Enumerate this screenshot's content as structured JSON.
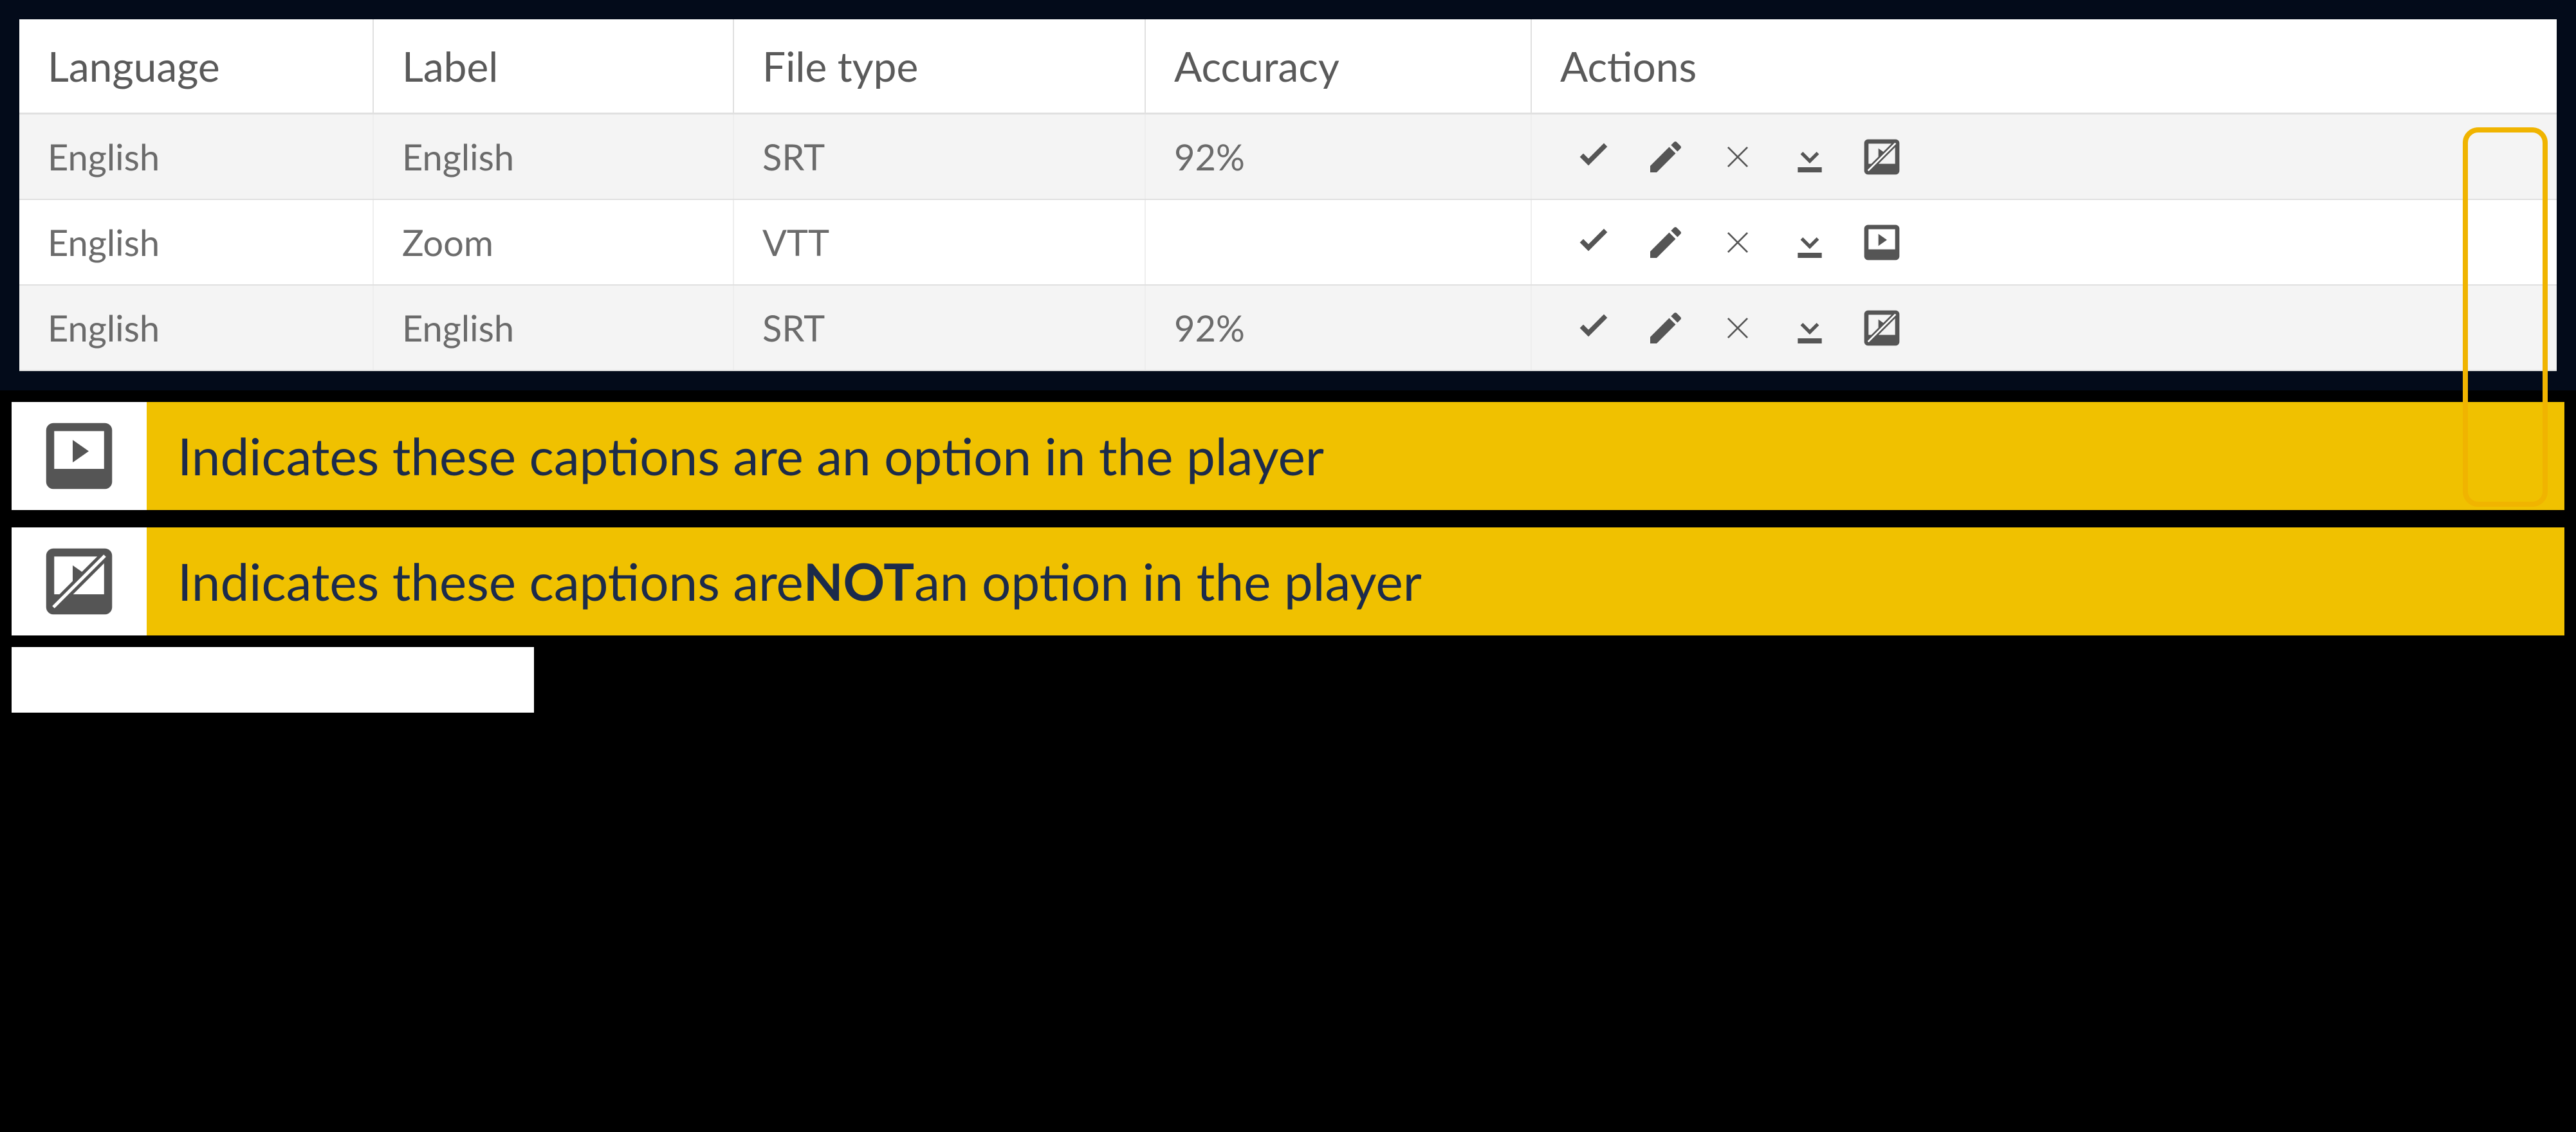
{
  "columns": {
    "language": "Language",
    "label": "Label",
    "file_type": "File type",
    "accuracy": "Accuracy",
    "actions": "Actions"
  },
  "rows": [
    {
      "language": "English",
      "label": "English",
      "file_type": "SRT",
      "accuracy": "92%",
      "player_option": false
    },
    {
      "language": "English",
      "label": "Zoom",
      "file_type": "VTT",
      "accuracy": "",
      "player_option": true
    },
    {
      "language": "English",
      "label": "English",
      "file_type": "SRT",
      "accuracy": "92%",
      "player_option": false
    }
  ],
  "legend": {
    "option_text": "Indicates these captions are an option in the player",
    "not_option_prefix": "Indicates these captions are ",
    "not_option_bold": "NOT",
    "not_option_suffix": " an option in the player"
  }
}
